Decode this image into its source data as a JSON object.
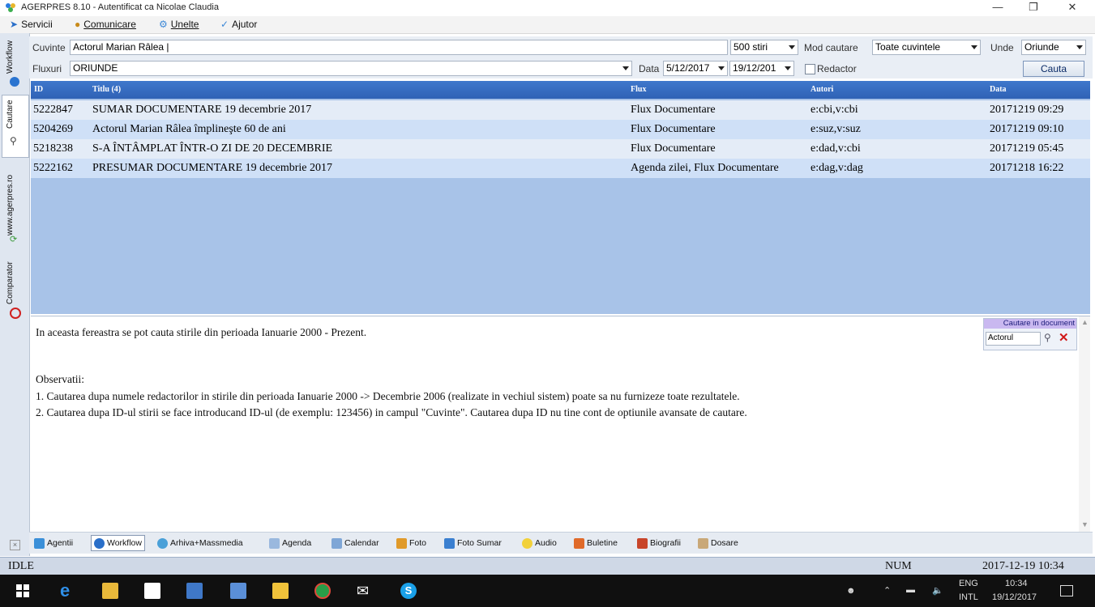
{
  "window": {
    "title": "AGERPRES 8.10 - Autentificat ca Nicolae Claudia"
  },
  "menu": {
    "items": [
      "Servicii",
      "Comunicare",
      "Unelte",
      "Ajutor"
    ]
  },
  "leftbar": {
    "tabs": [
      "Workflow",
      "Cautare",
      "www.agerpres.ro",
      "Comparator"
    ]
  },
  "search": {
    "cuvinte_label": "Cuvinte",
    "cuvinte_value": "Actorul Marian Râlea |",
    "count_value": "500 stiri",
    "mod_label": "Mod cautare",
    "mod_value": "Toate cuvintele",
    "unde_label": "Unde",
    "unde_value": "Oriunde",
    "fluxuri_label": "Fluxuri",
    "fluxuri_value": "ORIUNDE",
    "data_label": "Data",
    "date_from": "5/12/2017",
    "date_to": "19/12/201",
    "redactor_label": "Redactor",
    "button_label": "Cauta"
  },
  "grid": {
    "headers": {
      "id": "ID",
      "titlu": "Titlu (4)",
      "flux": "Flux",
      "autori": "Autori",
      "data": "Data"
    },
    "rows": [
      {
        "id": "5222847",
        "titlu": "SUMAR DOCUMENTARE 19 decembrie 2017",
        "flux": "Flux Documentare",
        "autori": "e:cbi,v:cbi",
        "data": "20171219 09:29"
      },
      {
        "id": "5204269",
        "titlu": "Actorul Marian Râlea împlineşte 60 de ani",
        "flux": "Flux Documentare",
        "autori": "e:suz,v:suz",
        "data": "20171219 09:10"
      },
      {
        "id": "5218238",
        "titlu": "S-A ÎNTÂMPLAT ÎNTR-O ZI DE 20 DECEMBRIE",
        "flux": "Flux Documentare",
        "autori": "e:dad,v:cbi",
        "data": "20171219 05:45"
      },
      {
        "id": "5222162",
        "titlu": "PRESUMAR DOCUMENTARE 19 decembrie 2017",
        "flux": "Agenda zilei, Flux Documentare",
        "autori": "e:dag,v:dag",
        "data": "20171218 16:22"
      }
    ]
  },
  "info": {
    "line1": "In aceasta fereastra se pot cauta stirile din perioada Ianuarie 2000 - Prezent.",
    "obs_title": "Observatii:",
    "obs1": "1. Cautarea dupa numele redactorilor in stirile din perioada Ianuarie 2000 -> Decembrie 2006 (realizate in vechiul sistem) poate sa nu furnizeze toate rezultatele.",
    "obs2": "2. Cautarea dupa ID-ul stirii se face introducand ID-ul (de exemplu: 123456) in campul \"Cuvinte\". Cautarea dupa ID nu tine cont de optiunile avansate de cautare.",
    "doc_search_title": "Cautare in document",
    "doc_search_value": "Actorul"
  },
  "tabs": [
    "Agentii",
    "Workflow",
    "Arhiva+Massmedia",
    "Agenda",
    "Calendar",
    "Foto",
    "Foto Sumar",
    "Audio",
    "Buletine",
    "Biografii",
    "Dosare"
  ],
  "status": {
    "state": "IDLE",
    "num": "NUM",
    "datetime": "2017-12-19 10:34"
  },
  "taskbar": {
    "lang1": "ENG",
    "lang2": "INTL",
    "time": "10:34",
    "date": "19/12/2017"
  },
  "colors": {
    "header_blue": "#2f62b5",
    "selected_row": "#cfe0f7",
    "grid_bg": "#a8c3e8"
  }
}
